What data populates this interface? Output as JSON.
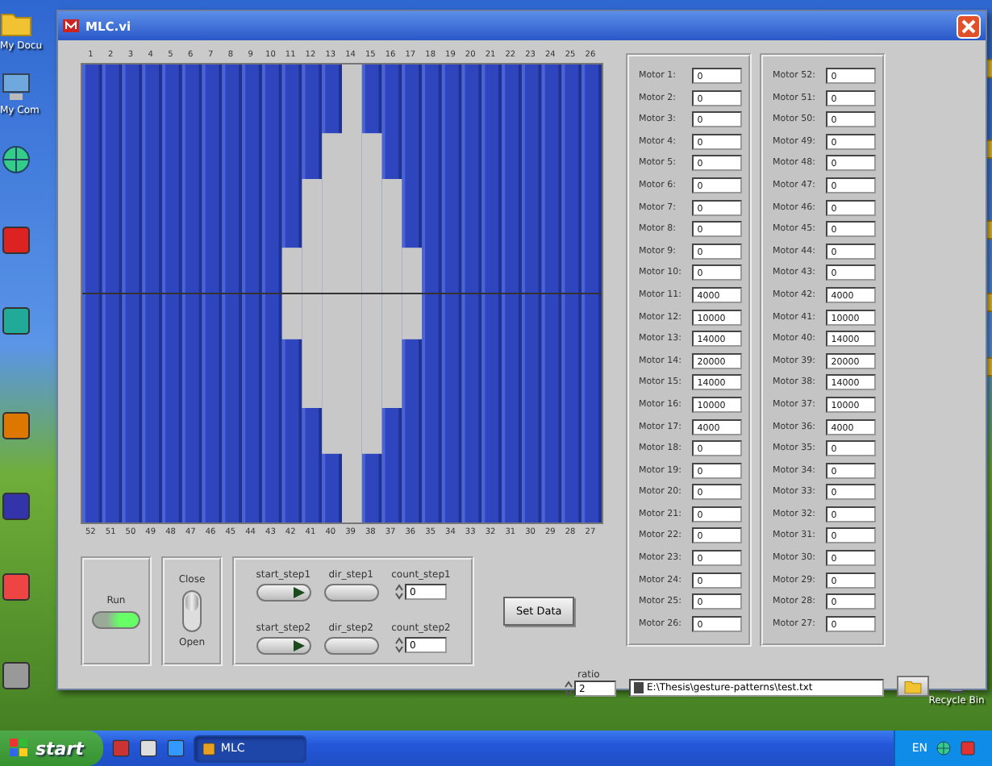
{
  "desktop": {
    "left_icons": [
      {
        "label": "My Docu"
      },
      {
        "label": "My Com"
      }
    ],
    "right_icons": [
      {
        "label": "Recycle Bin"
      }
    ]
  },
  "window": {
    "title": "MLC.vi",
    "graph": {
      "top_labels": [
        "1",
        "2",
        "3",
        "4",
        "5",
        "6",
        "7",
        "8",
        "9",
        "10",
        "11",
        "12",
        "13",
        "14",
        "15",
        "16",
        "17",
        "18",
        "19",
        "20",
        "21",
        "22",
        "23",
        "24",
        "25",
        "26"
      ],
      "bottom_labels": [
        "52",
        "51",
        "50",
        "49",
        "48",
        "47",
        "46",
        "45",
        "44",
        "43",
        "42",
        "41",
        "40",
        "39",
        "38",
        "37",
        "36",
        "35",
        "34",
        "33",
        "32",
        "31",
        "30",
        "29",
        "28",
        "27"
      ]
    },
    "run": {
      "label": "Run",
      "on": true
    },
    "switch": {
      "top_label": "Close",
      "bottom_label": "Open",
      "on": true
    },
    "step_buttons": [
      {
        "label": "start_step1",
        "on": true
      },
      {
        "label": "dir_step1",
        "on": false
      },
      {
        "label": "start_step2",
        "on": true
      },
      {
        "label": "dir_step2",
        "on": false
      }
    ],
    "counts": [
      {
        "label": "count_step1",
        "value": "0"
      },
      {
        "label": "count_step2",
        "value": "0"
      }
    ],
    "set_data_button": "Set Data",
    "ratio": {
      "label": "ratio",
      "value": "2"
    },
    "path": {
      "value": "E:\\Thesis\\gesture-patterns\\test.txt"
    },
    "motors_left": [
      {
        "label": "Motor 1:",
        "value": "0"
      },
      {
        "label": "Motor 2:",
        "value": "0"
      },
      {
        "label": "Motor 3:",
        "value": "0"
      },
      {
        "label": "Motor 4:",
        "value": "0"
      },
      {
        "label": "Motor 5:",
        "value": "0"
      },
      {
        "label": "Motor 6:",
        "value": "0"
      },
      {
        "label": "Motor 7:",
        "value": "0"
      },
      {
        "label": "Motor 8:",
        "value": "0"
      },
      {
        "label": "Motor 9:",
        "value": "0"
      },
      {
        "label": "Motor 10:",
        "value": "0"
      },
      {
        "label": "Motor 11:",
        "value": "4000"
      },
      {
        "label": "Motor 12:",
        "value": "10000"
      },
      {
        "label": "Motor 13:",
        "value": "14000"
      },
      {
        "label": "Motor 14:",
        "value": "20000"
      },
      {
        "label": "Motor 15:",
        "value": "14000"
      },
      {
        "label": "Motor 16:",
        "value": "10000"
      },
      {
        "label": "Motor 17:",
        "value": "4000"
      },
      {
        "label": "Motor 18:",
        "value": "0"
      },
      {
        "label": "Motor 19:",
        "value": "0"
      },
      {
        "label": "Motor 20:",
        "value": "0"
      },
      {
        "label": "Motor 21:",
        "value": "0"
      },
      {
        "label": "Motor 22:",
        "value": "0"
      },
      {
        "label": "Motor 23:",
        "value": "0"
      },
      {
        "label": "Motor 24:",
        "value": "0"
      },
      {
        "label": "Motor 25:",
        "value": "0"
      },
      {
        "label": "Motor 26:",
        "value": "0"
      }
    ],
    "motors_right": [
      {
        "label": "Motor 52:",
        "value": "0"
      },
      {
        "label": "Motor 51:",
        "value": "0"
      },
      {
        "label": "Motor 50:",
        "value": "0"
      },
      {
        "label": "Motor 49:",
        "value": "0"
      },
      {
        "label": "Motor 48:",
        "value": "0"
      },
      {
        "label": "Motor 47:",
        "value": "0"
      },
      {
        "label": "Motor 46:",
        "value": "0"
      },
      {
        "label": "Motor 45:",
        "value": "0"
      },
      {
        "label": "Motor 44:",
        "value": "0"
      },
      {
        "label": "Motor 43:",
        "value": "0"
      },
      {
        "label": "Motor 42:",
        "value": "4000"
      },
      {
        "label": "Motor 41:",
        "value": "10000"
      },
      {
        "label": "Motor 40:",
        "value": "14000"
      },
      {
        "label": "Motor 39:",
        "value": "20000"
      },
      {
        "label": "Motor 38:",
        "value": "14000"
      },
      {
        "label": "Motor 37:",
        "value": "10000"
      },
      {
        "label": "Motor 36:",
        "value": "4000"
      },
      {
        "label": "Motor 35:",
        "value": "0"
      },
      {
        "label": "Motor 34:",
        "value": "0"
      },
      {
        "label": "Motor 33:",
        "value": "0"
      },
      {
        "label": "Motor 32:",
        "value": "0"
      },
      {
        "label": "Motor 31:",
        "value": "0"
      },
      {
        "label": "Motor 30:",
        "value": "0"
      },
      {
        "label": "Motor 29:",
        "value": "0"
      },
      {
        "label": "Motor 28:",
        "value": "0"
      },
      {
        "label": "Motor 27:",
        "value": "0"
      }
    ]
  },
  "taskbar": {
    "start": "start",
    "tasks": [
      {
        "label": "MLC",
        "selected": true
      }
    ],
    "tray": "EN"
  }
}
